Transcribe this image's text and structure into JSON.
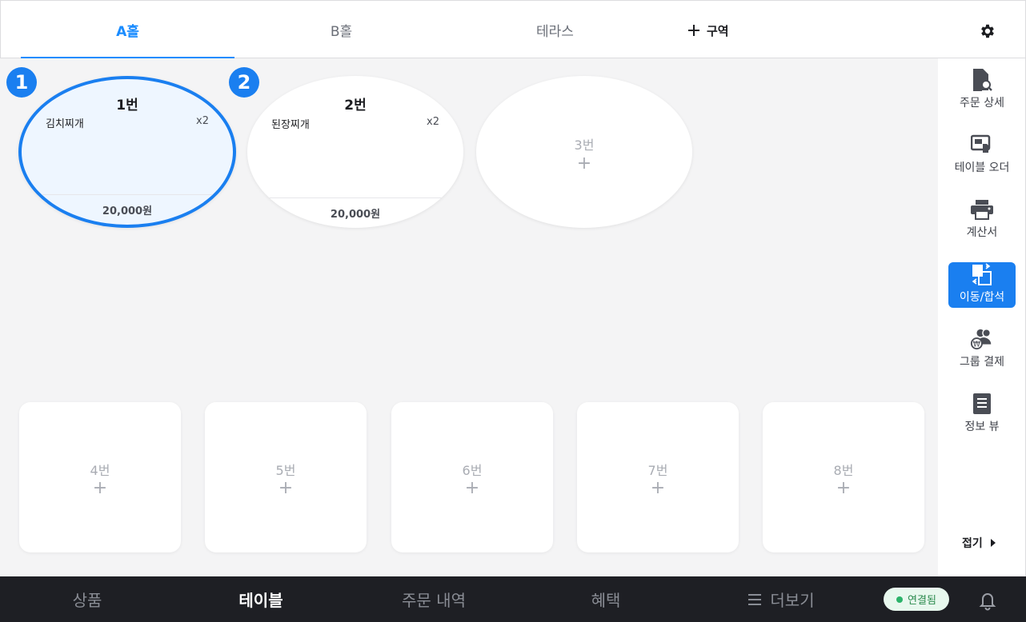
{
  "zones": {
    "tabs": [
      {
        "label": "A홀"
      },
      {
        "label": "B홀"
      },
      {
        "label": "테라스"
      }
    ],
    "add_label": "구역"
  },
  "icons": {
    "settings": "gear-icon",
    "add": "plus-icon",
    "bell": "bell-icon",
    "collapse": "caret-right-icon",
    "more": "hamburger-icon"
  },
  "tables": {
    "oval": [
      {
        "badge": "1",
        "name": "1번",
        "item": "김치찌개",
        "qty": "x2",
        "total": "20,000원",
        "selected": true
      },
      {
        "badge": "2",
        "name": "2번",
        "item": "된장찌개",
        "qty": "x2",
        "total": "20,000원",
        "selected": false
      },
      {
        "name": "3번",
        "plus": "+"
      }
    ],
    "rect": [
      {
        "name": "4번",
        "plus": "+"
      },
      {
        "name": "5번",
        "plus": "+"
      },
      {
        "name": "6번",
        "plus": "+"
      },
      {
        "name": "7번",
        "plus": "+"
      },
      {
        "name": "8번",
        "plus": "+"
      }
    ]
  },
  "sidebar": {
    "items": [
      {
        "label": "주문 상세",
        "icon": "order-detail-icon"
      },
      {
        "label": "테이블 오더",
        "icon": "table-order-icon"
      },
      {
        "label": "계산서",
        "icon": "printer-icon"
      },
      {
        "label": "이동/합석",
        "icon": "move-merge-icon",
        "active": true
      },
      {
        "label": "그룹 결제",
        "icon": "group-payment-icon"
      },
      {
        "label": "정보 뷰",
        "icon": "info-view-icon"
      }
    ],
    "collapse_label": "접기"
  },
  "bottom_nav": {
    "items": [
      {
        "label": "상품"
      },
      {
        "label": "테이블",
        "active": true
      },
      {
        "label": "주문 내역"
      },
      {
        "label": "혜택"
      },
      {
        "label": "더보기"
      }
    ],
    "status": "연결됨"
  },
  "colors": {
    "accent": "#1a7ff0",
    "selected_bg": "#eef6ff",
    "nav_bg": "#1e1f24",
    "status_green": "#2bb36a"
  }
}
